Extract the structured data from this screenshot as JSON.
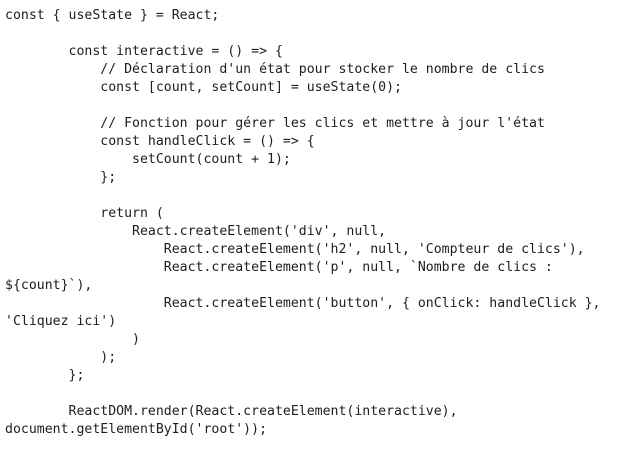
{
  "code": {
    "lines": [
      "const { useState } = React;",
      "",
      "        const interactive = () => {",
      "            // Déclaration d'un état pour stocker le nombre de clics",
      "            const [count, setCount] = useState(0);",
      "",
      "            // Fonction pour gérer les clics et mettre à jour l'état",
      "            const handleClick = () => {",
      "                setCount(count + 1);",
      "            };",
      "",
      "            return (",
      "                React.createElement('div', null,",
      "                    React.createElement('h2', null, 'Compteur de clics'),",
      "                    React.createElement('p', null, `Nombre de clics :",
      "${count}`),",
      "                    React.createElement('button', { onClick: handleClick },",
      "'Cliquez ici')",
      "                )",
      "            );",
      "        };",
      "",
      "        ReactDOM.render(React.createElement(interactive),",
      "document.getElementById('root'));"
    ]
  }
}
